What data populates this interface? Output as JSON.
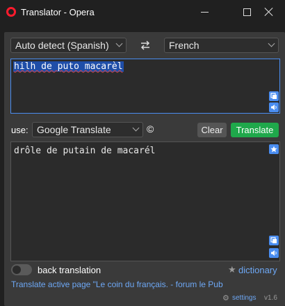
{
  "window": {
    "title": "Translator - Opera",
    "logo_icon": "opera-icon",
    "logo_color": "#ff1b2d"
  },
  "languages": {
    "source": "Auto detect (Spanish)",
    "target": "French",
    "swap_icon": "swap-arrows-icon"
  },
  "input": {
    "text": "hilh de puto macarèl",
    "copy_icon": "copy-icon",
    "speak_icon": "speaker-icon"
  },
  "engine": {
    "label": "use:",
    "selected": "Google Translate",
    "copyright_symbol": "©"
  },
  "actions": {
    "clear_label": "Clear",
    "translate_label": "Translate",
    "translate_color": "#1fa84b"
  },
  "output": {
    "text": "drôle de putain de macarél",
    "star_icon": "star-icon",
    "copy_icon": "copy-icon",
    "speak_icon": "speaker-icon"
  },
  "footer": {
    "back_translation_label": "back translation",
    "back_translation_on": false,
    "dictionary_label": "dictionary",
    "page_link": "Translate active page \"Le coin du français. - forum le Pub",
    "settings_label": "settings",
    "version": "v1.6",
    "link_color": "#6ea8f5"
  }
}
